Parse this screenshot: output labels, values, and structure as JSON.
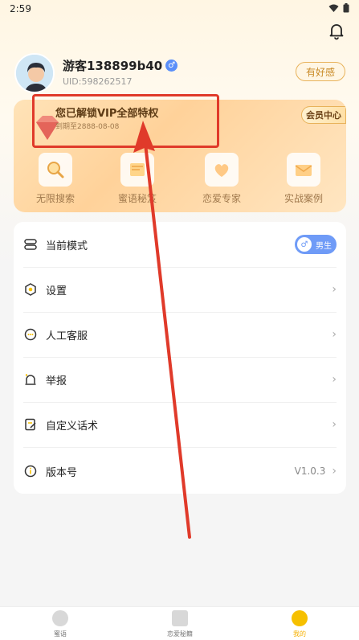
{
  "status": {
    "time": "2:59"
  },
  "profile": {
    "username": "游客138899b40",
    "uid": "UID:598262517",
    "good_feel_label": "有好感"
  },
  "vip": {
    "title": "您已解锁VIP全部特权",
    "expire": "到期至2888-08-08",
    "center_label": "会员中心",
    "features": [
      {
        "label": "无限搜索",
        "icon": "magnifier-icon"
      },
      {
        "label": "蜜语秘笈",
        "icon": "book-icon"
      },
      {
        "label": "恋爱专家",
        "icon": "chat-bubble-icon"
      },
      {
        "label": "实战案例",
        "icon": "envelope-icon"
      }
    ]
  },
  "menu": {
    "items": [
      {
        "label": "当前模式",
        "icon": "mode-icon",
        "toggle_label": "男生"
      },
      {
        "label": "设置",
        "icon": "settings-icon"
      },
      {
        "label": "人工客服",
        "icon": "customer-service-icon"
      },
      {
        "label": "举报",
        "icon": "report-icon"
      },
      {
        "label": "自定义话术",
        "icon": "edit-icon"
      },
      {
        "label": "版本号",
        "icon": "info-icon",
        "value": "V1.0.3"
      }
    ]
  },
  "tabbar": {
    "tabs": [
      {
        "label": "蜜语"
      },
      {
        "label": "恋爱秘籍"
      },
      {
        "label": "我的",
        "active": true
      }
    ]
  },
  "colors": {
    "accent_gold": "#c98a26",
    "annotation_red": "#e03a2a",
    "active_tab": "#f6c000"
  }
}
